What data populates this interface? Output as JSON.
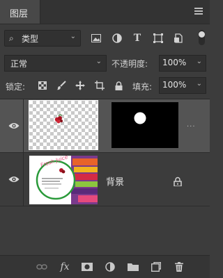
{
  "panel": {
    "tab_title": "图层"
  },
  "filter": {
    "kind_label": "类型"
  },
  "blend": {
    "mode": "正常",
    "opacity_label": "不透明度:",
    "opacity_value": "100%"
  },
  "lock": {
    "label": "锁定:",
    "fill_label": "填充:",
    "fill_value": "100%"
  },
  "layers": [
    {
      "name": "",
      "selected": true,
      "visible": true
    },
    {
      "name": "背景",
      "selected": false,
      "visible": true,
      "locked": true
    }
  ],
  "background_thumb": {
    "title_text": "Fresh Juice"
  }
}
